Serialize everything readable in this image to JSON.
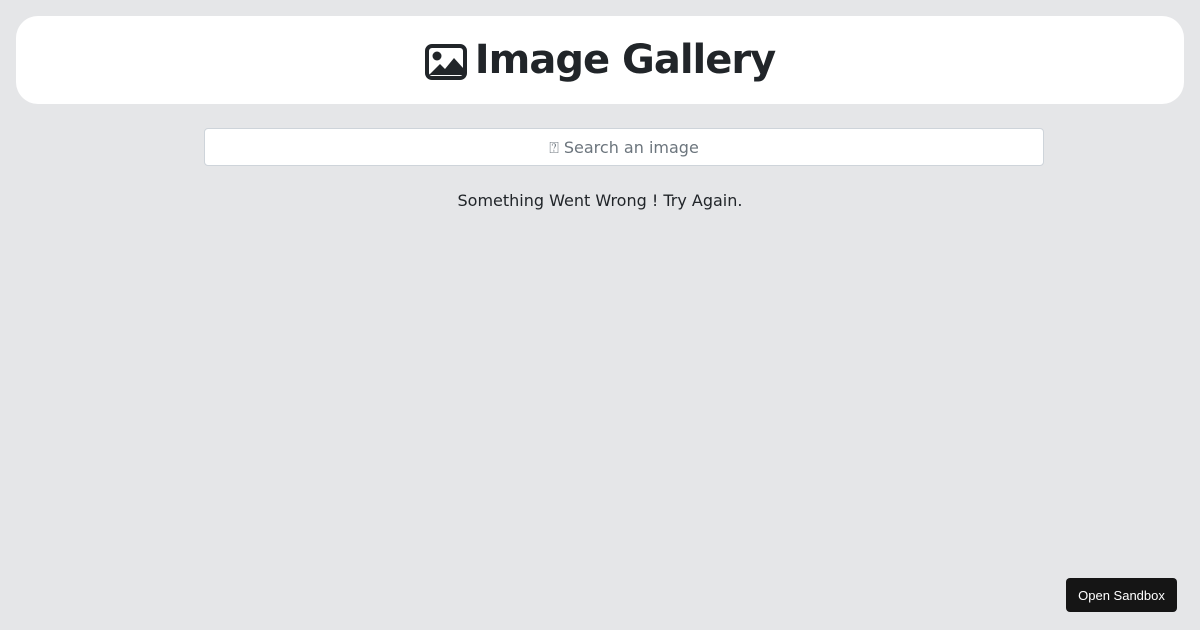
{
  "header": {
    "icon": "image-icon",
    "title": "Image Gallery"
  },
  "search": {
    "placeholder": "⍰ Search an image",
    "value": ""
  },
  "status": {
    "error_message": "Something Went Wrong ! Try Again."
  },
  "sandbox": {
    "label": "Open Sandbox"
  },
  "colors": {
    "background": "#e5e6e8",
    "header_bg": "#ffffff",
    "text": "#212529",
    "button_bg": "#151515"
  }
}
